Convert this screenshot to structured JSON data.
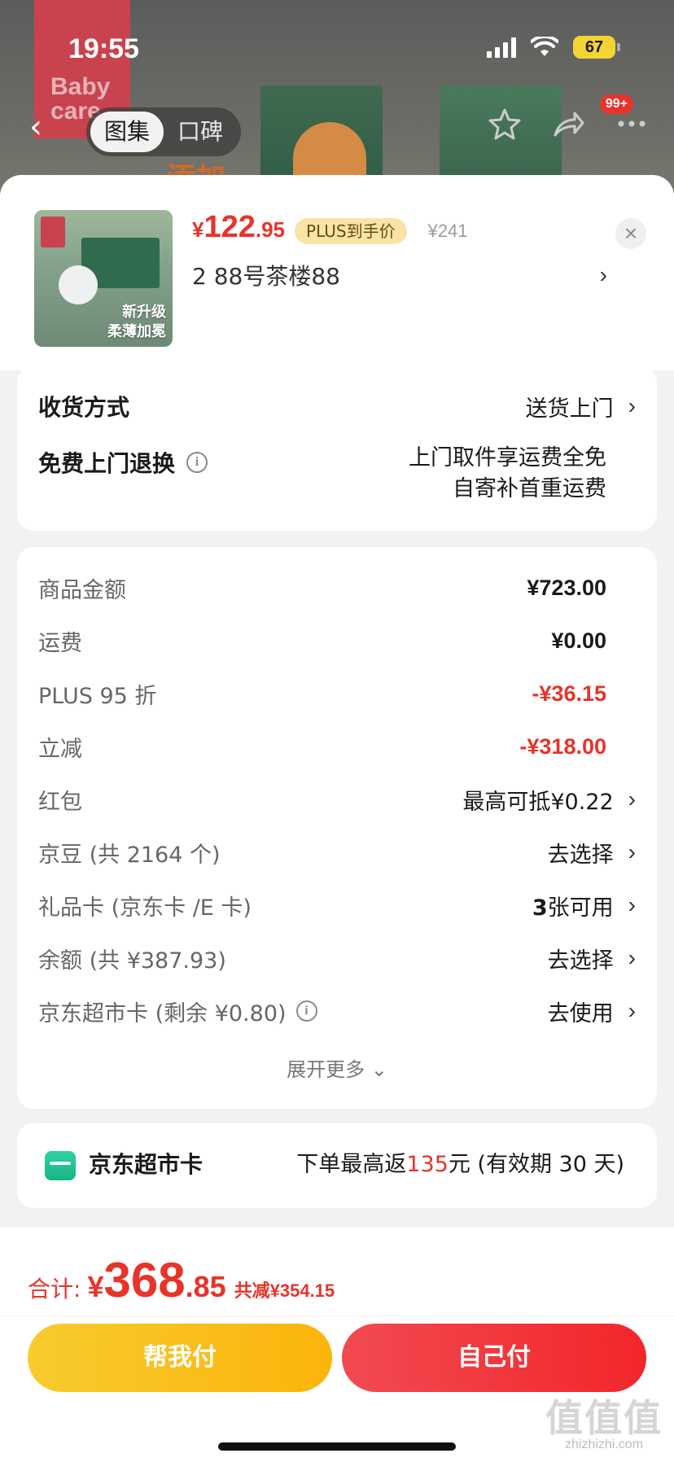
{
  "status_bar": {
    "time": "19:55",
    "battery": "67"
  },
  "header": {
    "brand_text": "Baby care",
    "tabs": [
      {
        "label": "图集",
        "active": true
      },
      {
        "label": "口碑",
        "active": false
      }
    ],
    "message_badge": "99+",
    "bg_text": "添加"
  },
  "product": {
    "thumb_caption_line1": "新升级",
    "thumb_caption_line2": "柔薄加冕",
    "price_symbol": "¥",
    "price_integer": "122",
    "price_decimal": ".95",
    "plus_tag": "PLUS到手价",
    "original_price": "¥241",
    "spec": "2  88号茶楼88"
  },
  "delivery": {
    "method_label": "收货方式",
    "method_value": "送货上门",
    "return_label": "免费上门退换",
    "return_line1": "上门取件享运费全免",
    "return_line2": "自寄补首重运费"
  },
  "money": {
    "rows": [
      {
        "label": "商品金额",
        "value": "¥723.00"
      },
      {
        "label": "运费",
        "value": "¥0.00"
      },
      {
        "label": "PLUS 95 折",
        "value": "-¥36.15"
      },
      {
        "label": "立减",
        "value": "-¥318.00"
      },
      {
        "label": "红包",
        "value": "最高可抵¥0.22"
      },
      {
        "label": "京豆 (共 2164 个)",
        "value": "去选择"
      },
      {
        "label": "礼品卡 (京东卡 /E 卡)",
        "value_bold": "3",
        "value": "张可用"
      },
      {
        "label": "余额 (共 ¥387.93)",
        "value": "去选择"
      },
      {
        "label": "京东超市卡 (剩余 ¥0.80)",
        "value": "去使用"
      }
    ],
    "expand_more": "展开更多"
  },
  "supermarket_card": {
    "title": "京东超市卡",
    "desc_prefix": "下单最高返",
    "desc_amount": "135",
    "desc_suffix": "元 (有效期 30 天)"
  },
  "footer": {
    "total_label": "合计:",
    "total_symbol": "¥",
    "total_integer": "368",
    "total_decimal": ".85",
    "saved": "共减¥354.15",
    "help_pay": "帮我付",
    "self_pay": "自己付"
  },
  "watermark": {
    "logo": "值值值",
    "url": "zhizhizhi.com"
  },
  "colors": {
    "accent_red": "#e8332a",
    "plus_gold": "#fbe3a8",
    "help_yellow": "#f8cb2e",
    "self_red": "#f2262a",
    "super_green": "#17b486"
  }
}
